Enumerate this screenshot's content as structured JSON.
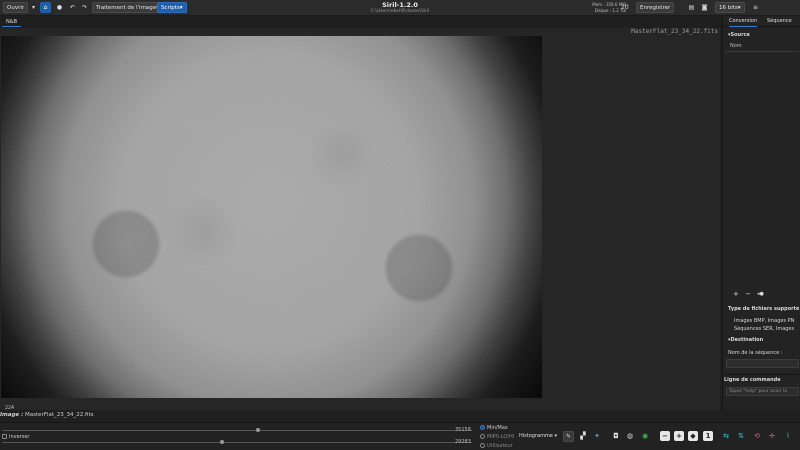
{
  "header": {
    "open_label": "Ouvrir",
    "open_arrow": "▾",
    "home_icon": "home-icon",
    "cwd_icon": "directory-icon",
    "undo_icon": "undo-icon",
    "redo_icon": "redo-icon",
    "image_processing_label": "Traitement de l'image▾",
    "scripts_label": "Scripts▾",
    "title": "Siril-1.2.0",
    "path": "C:\\Users\\okel\\Pictures\\Siril",
    "memory": "Mem : 356.6 MiB",
    "disk": "Disque : 1.2 Tib",
    "zoom_level": "20",
    "save_label": "Enregistrer",
    "save_menu_icon": "save-options-icon",
    "snapshot_icon": "camera-icon",
    "bitdepth_label": "16 bits▾",
    "menu_icon": "hamburger-icon"
  },
  "tabs": {
    "left_tab": "N&B"
  },
  "image": {
    "filename_overlay": "MasterFlat_23_34_22.fits"
  },
  "right_panel": {
    "tab_conversion": "Conversion",
    "tab_sequence": "Séquence",
    "source_header": "▾Source",
    "name_col": "Nom",
    "add_icon": "+",
    "remove_icon": "−",
    "clear_icon": "◂●",
    "file_types_title": "Type de fichiers supporté",
    "file_types_line1": "Images BMP, Images PN",
    "file_types_line2": "Séquences SER, Images",
    "destination_header": "▾Destination",
    "sequence_name_label": "Nom de la séquence :",
    "command_line_title": "Ligne de commande",
    "command_placeholder": "Tapez \"help\" pour avoir la"
  },
  "status": {
    "coordinate_readout": "224",
    "image_label": "Image :",
    "image_filename": "MasterFlat_23_34_22.fits",
    "invert_label": "Inverser",
    "max_value": "35158",
    "min_value": "29283",
    "minmax_option": "Min/Max",
    "mips_option": "MIPS-LO/HI",
    "user_option": "Utilisateur",
    "histogram_dropdown": "Histogramme ▾"
  },
  "colors": {
    "accent": "#1f5ea8",
    "background": "#1f1f1f",
    "panel": "#232323"
  }
}
